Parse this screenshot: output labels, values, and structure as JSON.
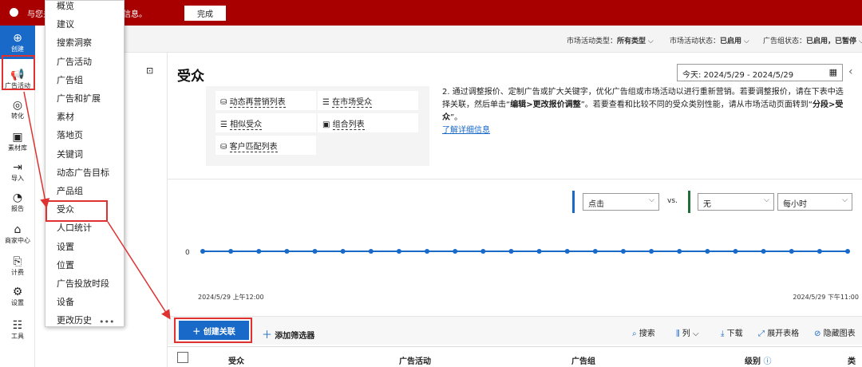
{
  "banner": {
    "text": "与您关联的广告中缺少必填信息。",
    "done_label": "完成"
  },
  "leftnav": [
    {
      "icon": "plus-circle-icon",
      "glyph": "⊕",
      "label": "创建"
    },
    {
      "icon": "megaphone-icon",
      "glyph": "📢",
      "label": "广告活动"
    },
    {
      "icon": "target-icon",
      "glyph": "◎",
      "label": "转化"
    },
    {
      "icon": "library-icon",
      "glyph": "▣",
      "label": "素材库"
    },
    {
      "icon": "import-icon",
      "glyph": "⇥",
      "label": "导入"
    },
    {
      "icon": "report-icon",
      "glyph": "◔",
      "label": "报告"
    },
    {
      "icon": "store-icon",
      "glyph": "⌂",
      "label": "商家中心"
    },
    {
      "icon": "billing-icon",
      "glyph": "⎘",
      "label": "计费"
    },
    {
      "icon": "gear-icon",
      "glyph": "⚙",
      "label": "设置"
    },
    {
      "icon": "tools-icon",
      "glyph": "☷",
      "label": "工具"
    }
  ],
  "filters": [
    {
      "label": "市场活动类型：",
      "value": "所有类型"
    },
    {
      "label": "市场活动状态：",
      "value": "已启用"
    },
    {
      "label": "广告组状态：",
      "value": "已启用，已暂停"
    }
  ],
  "menu": {
    "items": [
      "概览",
      "建议",
      "搜索洞察",
      "广告活动",
      "广告组",
      "广告和扩展",
      "素材",
      "落地页",
      "关键词",
      "动态广告目标",
      "产品组",
      "受众",
      "人口统计",
      "设置",
      "位置",
      "广告投放时段",
      "设备",
      "更改历史"
    ],
    "selected": "受众"
  },
  "page": {
    "title": "受众",
    "date_range": "今天: 2024/5/29 - 2024/5/29"
  },
  "audience_types": [
    {
      "icon": "list-icon",
      "glyph": "⛁",
      "label": "动态再营销列表"
    },
    {
      "icon": "list-icon",
      "glyph": "☰",
      "label": "在市场受众"
    },
    {
      "icon": "list-icon",
      "glyph": "☰",
      "label": "相似受众"
    },
    {
      "icon": "combo-icon",
      "glyph": "▣",
      "label": "组合列表"
    },
    {
      "icon": "customer-icon",
      "glyph": "⛁",
      "label": "客户匹配列表"
    }
  ],
  "note": {
    "text_a": "2. 通过调整报价、定制广告或扩大关键字，优化广告组或市场活动以进行重新营销。若要调整报价，请在下表中选择关联，然后单击“",
    "bold_a": "编辑",
    "text_b": ">",
    "bold_b": "更改报价调整",
    "text_c": "”。若要查看和比较不同的受众类别性能，请从市场活动页面转到“",
    "bold_c": "分段",
    "text_d": ">",
    "bold_d": "受众",
    "text_e": "”。",
    "link": "了解详细信息"
  },
  "chart_controls": {
    "metric1": "点击",
    "vs": "vs.",
    "metric2": "无",
    "interval": "每小时"
  },
  "chart_data": {
    "type": "line",
    "y_tick": "0",
    "x_start_label": "2024/5/29 上午12:00",
    "x_end_label": "2024/5/29 下午11:00",
    "values": [
      0,
      0,
      0,
      0,
      0,
      0,
      0,
      0,
      0,
      0,
      0,
      0,
      0,
      0,
      0,
      0,
      0,
      0,
      0,
      0,
      0,
      0,
      0,
      0
    ],
    "ylim": [
      0,
      1
    ],
    "color": "#1969c9"
  },
  "toolbar": {
    "create_label": "创建关联",
    "add_filter_label": "添加筛选器",
    "search": "搜索",
    "columns": "列",
    "download": "下载",
    "expand": "展开表格",
    "hide_chart": "隐藏图表"
  },
  "table": {
    "headers": [
      "受众",
      "广告活动",
      "广告组",
      "级别",
      "类别"
    ]
  }
}
